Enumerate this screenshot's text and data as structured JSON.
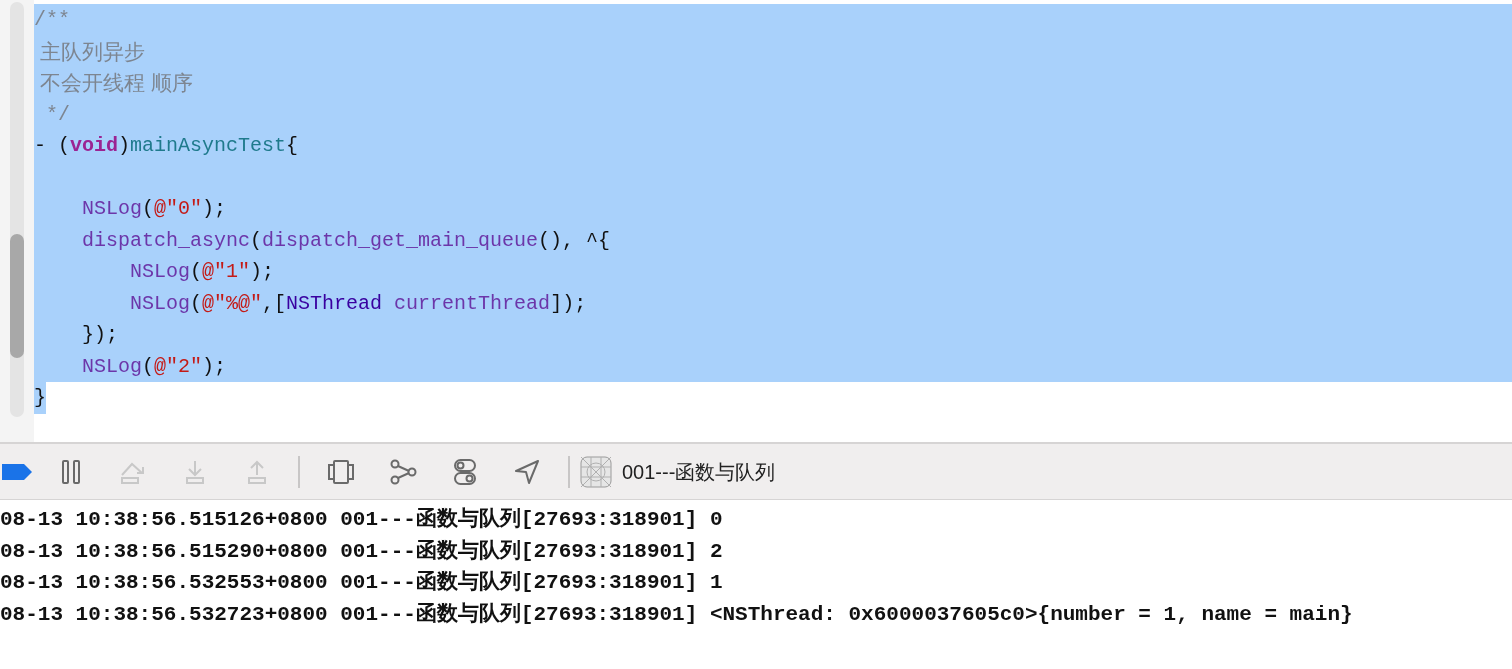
{
  "editor": {
    "lines": [
      {
        "selected": true,
        "tokens": [
          {
            "kind": "comment",
            "text": "/**"
          }
        ]
      },
      {
        "selected": true,
        "tokens": [
          {
            "kind": "comment",
            "text": " 主队列异步"
          }
        ]
      },
      {
        "selected": true,
        "tokens": [
          {
            "kind": "comment",
            "text": " 不会开线程 顺序"
          }
        ]
      },
      {
        "selected": true,
        "tokens": [
          {
            "kind": "comment",
            "text": " */"
          }
        ]
      },
      {
        "selected": true,
        "tokens": [
          {
            "kind": "plain",
            "text": "- ("
          },
          {
            "kind": "keyword",
            "text": "void"
          },
          {
            "kind": "plain",
            "text": ")"
          },
          {
            "kind": "declaration",
            "text": "mainAsyncTest"
          },
          {
            "kind": "plain",
            "text": "{"
          }
        ]
      },
      {
        "selected": true
      },
      {
        "selected": true,
        "tokens": [
          {
            "kind": "function",
            "text": "    NSLog"
          },
          {
            "kind": "plain",
            "text": "("
          },
          {
            "kind": "string",
            "text": "@\"0\""
          },
          {
            "kind": "plain",
            "text": ");"
          }
        ]
      },
      {
        "selected": true,
        "tokens": [
          {
            "kind": "function",
            "text": "    dispatch_async"
          },
          {
            "kind": "plain",
            "text": "("
          },
          {
            "kind": "function",
            "text": "dispatch_get_main_queue"
          },
          {
            "kind": "plain",
            "text": "(), ^{"
          }
        ]
      },
      {
        "selected": true,
        "tokens": [
          {
            "kind": "function",
            "text": "        NSLog"
          },
          {
            "kind": "plain",
            "text": "("
          },
          {
            "kind": "string",
            "text": "@\"1\""
          },
          {
            "kind": "plain",
            "text": ");"
          }
        ]
      },
      {
        "selected": true,
        "tokens": [
          {
            "kind": "function",
            "text": "        NSLog"
          },
          {
            "kind": "plain",
            "text": "("
          },
          {
            "kind": "string",
            "text": "@\"%@\""
          },
          {
            "kind": "plain",
            "text": ",["
          },
          {
            "kind": "class",
            "text": "NSThread"
          },
          {
            "kind": "function",
            "text": " currentThread"
          },
          {
            "kind": "plain",
            "text": "]);"
          }
        ]
      },
      {
        "selected": true,
        "tokens": [
          {
            "kind": "plain",
            "text": "    });"
          }
        ]
      },
      {
        "selected": true,
        "tokens": [
          {
            "kind": "function",
            "text": "    NSLog"
          },
          {
            "kind": "plain",
            "text": "("
          },
          {
            "kind": "string",
            "text": "@\"2\""
          },
          {
            "kind": "plain",
            "text": ");"
          }
        ]
      },
      {
        "selected": true,
        "tokens": [
          {
            "kind": "plain",
            "text": "}"
          }
        ]
      }
    ]
  },
  "debug_bar": {
    "groups": [
      [
        {
          "kind": "breakpoints",
          "disabled": false
        },
        {
          "kind": "pause",
          "disabled": false
        },
        {
          "kind": "step_over",
          "disabled": true
        },
        {
          "kind": "step_into",
          "disabled": true
        },
        {
          "kind": "step_out",
          "disabled": true
        }
      ],
      [
        {
          "kind": "view_debugger",
          "disabled": false
        },
        {
          "kind": "memory_graph",
          "disabled": false
        },
        {
          "kind": "environment",
          "disabled": false
        },
        {
          "kind": "location",
          "disabled": false
        }
      ]
    ],
    "target": "001---函数与队列"
  },
  "console": {
    "lines": [
      "08-13 10:38:56.515126+0800 001---函数与队列[27693:318901] 0",
      "08-13 10:38:56.515290+0800 001---函数与队列[27693:318901] 2",
      "08-13 10:38:56.532553+0800 001---函数与队列[27693:318901] 1",
      "08-13 10:38:56.532723+0800 001---函数与队列[27693:318901] <NSThread: 0x6000037605c0>{number = 1, name = main}"
    ]
  }
}
